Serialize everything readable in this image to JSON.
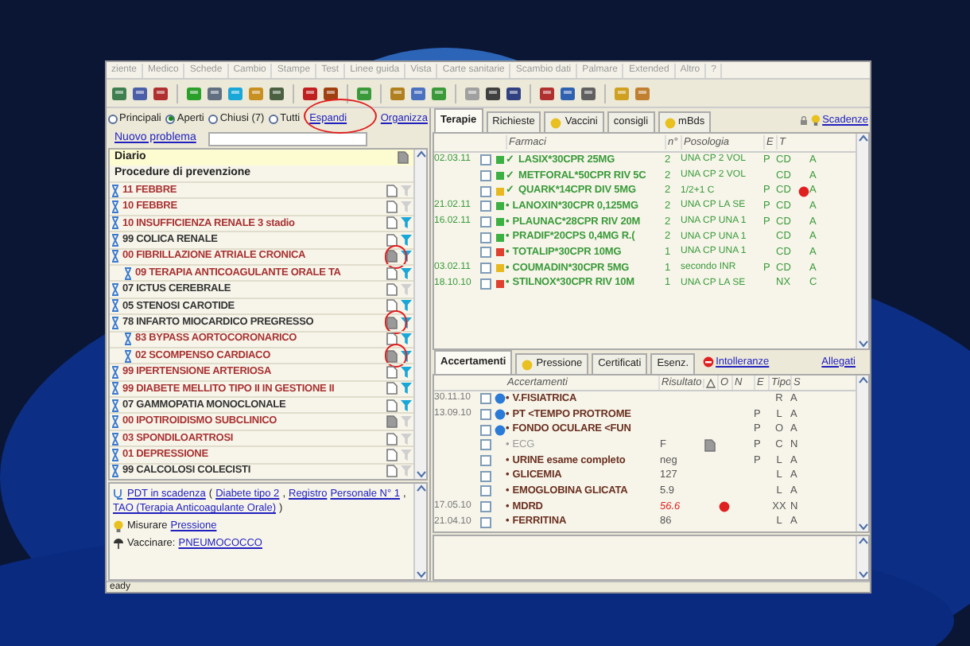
{
  "menu": [
    "ziente",
    "Medico",
    "Schede",
    "Cambio",
    "Stampe",
    "Test",
    "Linee guida",
    "Vista",
    "Carte sanitarie",
    "Scambio dati",
    "Palmare",
    "Extended",
    "Altro",
    "?"
  ],
  "left": {
    "filters": [
      {
        "label": "Principali",
        "selected": false
      },
      {
        "label": "Aperti",
        "selected": true
      },
      {
        "label": "Chiusi (7)",
        "selected": false
      },
      {
        "label": "Tutti",
        "selected": false
      }
    ],
    "expand_link": {
      "label": "Espandi",
      "circled": true
    },
    "organize_link": "Organizza",
    "new_problem": "Nuovo problema",
    "diary": [
      {
        "label": "Diario",
        "highlighted": true
      },
      {
        "label": "Procedure di prevenzione",
        "highlighted": false
      }
    ],
    "problems": [
      {
        "label": "11 FEBBRE",
        "color": "#a83232",
        "note": false,
        "filter": false,
        "circled": false
      },
      {
        "label": "10 FEBBRE",
        "color": "#a83232",
        "note": false,
        "filter": false,
        "circled": false
      },
      {
        "label": "10 INSUFFICIENZA RENALE 3 stadio",
        "color": "#a83232",
        "note": false,
        "filter": true,
        "circled": false
      },
      {
        "label": "99 COLICA RENALE",
        "color": "#333333",
        "note": false,
        "filter": true,
        "circled": false
      },
      {
        "label": "00 FIBRILLAZIONE ATRIALE CRONICA",
        "color": "#a83232",
        "note": true,
        "filter": true,
        "circled": true,
        "children": [
          {
            "label": "09 TERAPIA ANTICOAGULANTE ORALE TA",
            "color": "#a83232",
            "note": false,
            "filter": true,
            "circled": false
          }
        ]
      },
      {
        "label": "07 ICTUS CEREBRALE",
        "color": "#333333",
        "note": false,
        "filter": false,
        "circled": false
      },
      {
        "label": "05 STENOSI CAROTIDE",
        "color": "#333333",
        "note": false,
        "filter": true,
        "circled": false
      },
      {
        "label": "78 INFARTO MIOCARDICO PREGRESSO",
        "color": "#333333",
        "note": true,
        "filter": true,
        "circled": true,
        "children": [
          {
            "label": "83 BYPASS AORTOCORONARICO",
            "color": "#a83232",
            "note": false,
            "filter": true,
            "circled": false
          },
          {
            "label": "02 SCOMPENSO CARDIACO",
            "color": "#a83232",
            "note": true,
            "filter": true,
            "circled": true
          }
        ]
      },
      {
        "label": "99 IPERTENSIONE ARTERIOSA",
        "color": "#a83232",
        "note": false,
        "filter": true,
        "circled": false
      },
      {
        "label": "99 DIABETE MELLITO TIPO II IN GESTIONE II",
        "color": "#a83232",
        "note": false,
        "filter": true,
        "circled": false
      },
      {
        "label": "07 GAMMOPATIA MONOCLONALE",
        "color": "#333333",
        "note": false,
        "filter": true,
        "circled": false
      },
      {
        "label": "00 IPOTIROIDISMO SUBCLINICO",
        "color": "#a83232",
        "note": true,
        "filter": false,
        "circled": false
      },
      {
        "label": "03 SPONDILOARTROSI",
        "color": "#a83232",
        "note": false,
        "filter": false,
        "circled": false
      },
      {
        "label": "01 DEPRESSIONE",
        "color": "#a83232",
        "note": false,
        "filter": false,
        "circled": false
      },
      {
        "label": "99 CALCOLOSI COLECISTI",
        "color": "#333333",
        "note": false,
        "filter": false,
        "circled": false
      }
    ],
    "info": [
      {
        "kind": "pdt",
        "parts": [
          {
            "text": "PDT in scadenza",
            "link": true
          },
          {
            "text": "(",
            "link": false
          },
          {
            "text": "Diabete tipo 2",
            "link": true
          },
          {
            "text": ",",
            "link": false
          },
          {
            "text": "Registro",
            "link": true
          },
          {
            "text": "Personale N° 1",
            "link": true
          },
          {
            "text": ",",
            "link": false
          },
          {
            "text": "TAO (Terapia Anticoagulante Orale)",
            "link": true
          },
          {
            "text": ")",
            "link": false
          }
        ]
      },
      {
        "kind": "measure",
        "parts": [
          {
            "text": "Misurare",
            "link": false
          },
          {
            "text": "Pressione",
            "link": true
          }
        ]
      },
      {
        "kind": "vaccine",
        "parts": [
          {
            "text": "Vaccinare:",
            "link": false
          },
          {
            "text": "PNEUMOCOCCO",
            "link": true
          }
        ]
      }
    ]
  },
  "therapy": {
    "tabs": [
      {
        "label": "Terapie",
        "selected": true,
        "kind": "plain"
      },
      {
        "label": "Richieste",
        "selected": false,
        "kind": "plain"
      },
      {
        "label": "Vaccini",
        "selected": false,
        "kind": "dot"
      },
      {
        "label": "consigli",
        "selected": false,
        "kind": "plain"
      },
      {
        "label": "mBds",
        "selected": false,
        "kind": "dot"
      }
    ],
    "deadline_link": "Scadenze",
    "columns": [
      "Farmaci",
      "n°",
      "Posologia",
      "E",
      "T"
    ],
    "rows": [
      {
        "date": "02.03.11",
        "checked": false,
        "color": "#3cb043",
        "mark": "✓",
        "name": "LASIX*30CPR 25MG",
        "n": "2",
        "dose": "UNA CP 2 VOL",
        "e": "P",
        "t": "CD",
        "alert": false,
        "s": "A"
      },
      {
        "date": "",
        "checked": false,
        "color": "#3cb043",
        "mark": "✓",
        "name": "METFORAL*50CPR RIV 5C",
        "n": "2",
        "dose": "UNA CP 2 VOL",
        "e": "",
        "t": "CD",
        "alert": false,
        "s": "A"
      },
      {
        "date": "",
        "checked": false,
        "color": "#e8b820",
        "mark": "✓",
        "name": "QUARK*14CPR DIV 5MG",
        "n": "2",
        "dose": "1/2+1 C",
        "e": "P",
        "t": "CD",
        "alert": true,
        "s": "A"
      },
      {
        "date": "21.02.11",
        "checked": false,
        "color": "#3cb043",
        "mark": "•",
        "name": "LANOXIN*30CPR 0,125MG",
        "n": "2",
        "dose": "UNA CP LA SE",
        "e": "P",
        "t": "CD",
        "alert": false,
        "s": "A"
      },
      {
        "date": "16.02.11",
        "checked": false,
        "color": "#3cb043",
        "mark": "•",
        "name": "PLAUNAC*28CPR RIV 20M",
        "n": "2",
        "dose": "UNA CP UNA 1",
        "e": "P",
        "t": "CD",
        "alert": false,
        "s": "A"
      },
      {
        "date": "",
        "checked": false,
        "color": "#3cb043",
        "mark": "•",
        "name": "PRADIF*20CPS 0,4MG R.(",
        "n": "2",
        "dose": "UNA CP UNA 1",
        "e": "",
        "t": "CD",
        "alert": false,
        "s": "A"
      },
      {
        "date": "",
        "checked": false,
        "color": "#e04030",
        "mark": "•",
        "name": "TOTALIP*30CPR 10MG",
        "n": "1",
        "dose": "UNA CP UNA 1",
        "e": "",
        "t": "CD",
        "alert": false,
        "s": "A"
      },
      {
        "date": "03.02.11",
        "checked": false,
        "color": "#e8b820",
        "mark": "•",
        "name": "COUMADIN*30CPR 5MG",
        "n": "1",
        "dose": "secondo INR",
        "e": "P",
        "t": "CD",
        "alert": false,
        "s": "A"
      },
      {
        "date": "18.10.10",
        "checked": false,
        "color": "#e04030",
        "mark": "•",
        "name": "STILNOX*30CPR RIV 10M",
        "n": "1",
        "dose": "UNA CP LA SE",
        "e": "",
        "t": "NX",
        "alert": false,
        "s": "C"
      }
    ]
  },
  "tests": {
    "tabs": [
      {
        "label": "Accertamenti",
        "selected": true,
        "kind": "plain"
      },
      {
        "label": "Pressione",
        "selected": false,
        "kind": "dot"
      },
      {
        "label": "Certificati",
        "selected": false,
        "kind": "plain"
      },
      {
        "label": "Esenz.",
        "selected": false,
        "kind": "plain"
      }
    ],
    "intolerance_link": "Intolleranze",
    "attachments_link": "Allegati",
    "columns": [
      "Accertamenti",
      "Risultato",
      "O",
      "N",
      "E",
      "Tipo",
      "S"
    ],
    "rows": [
      {
        "date": "30.11.10",
        "checked": false,
        "dot": true,
        "mark": "•",
        "name": "V.FISIATRICA",
        "result": "",
        "high": false,
        "attachment": false,
        "flag": false,
        "e": "",
        "tipo": "R",
        "s": "A",
        "dimmed": false
      },
      {
        "date": "13.09.10",
        "checked": false,
        "dot": true,
        "mark": "•",
        "name": "PT <TEMPO PROTROME",
        "result": "",
        "high": false,
        "attachment": false,
        "flag": false,
        "e": "P",
        "tipo": "L",
        "s": "A",
        "dimmed": false
      },
      {
        "date": "",
        "checked": false,
        "dot": true,
        "mark": "•",
        "name": "FONDO OCULARE <FUN",
        "result": "",
        "high": false,
        "attachment": false,
        "flag": false,
        "e": "P",
        "tipo": "O",
        "s": "A",
        "dimmed": false
      },
      {
        "date": "",
        "checked": false,
        "dot": false,
        "mark": "•",
        "name": "ECG",
        "result": "F",
        "high": false,
        "attachment": true,
        "flag": false,
        "e": "P",
        "tipo": "C",
        "s": "N",
        "dimmed": true
      },
      {
        "date": "",
        "checked": false,
        "dot": false,
        "mark": "•",
        "name": "URINE esame completo",
        "result": "neg",
        "high": false,
        "attachment": false,
        "flag": false,
        "e": "P",
        "tipo": "L",
        "s": "A",
        "dimmed": false
      },
      {
        "date": "",
        "checked": false,
        "dot": false,
        "mark": "•",
        "name": "GLICEMIA",
        "result": "127",
        "high": false,
        "attachment": false,
        "flag": false,
        "e": "",
        "tipo": "L",
        "s": "A",
        "dimmed": false
      },
      {
        "date": "",
        "checked": false,
        "dot": false,
        "mark": "•",
        "name": "EMOGLOBINA GLICATA",
        "result": "5.9",
        "high": false,
        "attachment": false,
        "flag": false,
        "e": "",
        "tipo": "L",
        "s": "A",
        "dimmed": false
      },
      {
        "date": "17.05.10",
        "checked": false,
        "dot": false,
        "mark": "•",
        "name": "MDRD",
        "result": "56.6",
        "high": true,
        "attachment": false,
        "flag": true,
        "e": "",
        "tipo": "XX",
        "s": "N",
        "dimmed": false
      },
      {
        "date": "21.04.10",
        "checked": false,
        "dot": false,
        "mark": "•",
        "name": "FERRITINA",
        "result": "86",
        "high": false,
        "attachment": false,
        "flag": false,
        "e": "",
        "tipo": "L",
        "s": "A",
        "dimmed": false
      }
    ]
  },
  "status_bar": "eady"
}
